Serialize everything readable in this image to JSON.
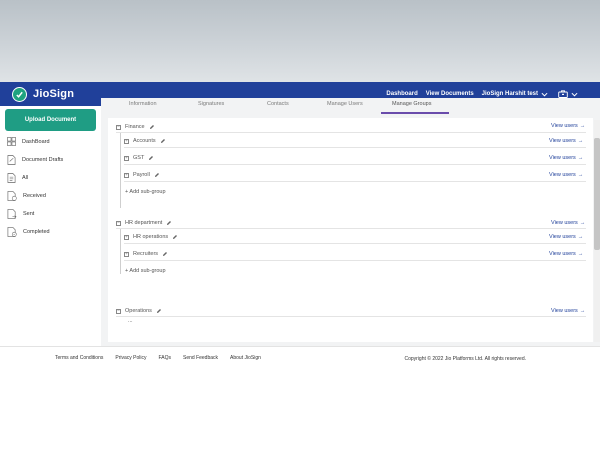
{
  "app": {
    "name": "JioSign"
  },
  "navbar": {
    "links": [
      "Dashboard",
      "View Documents"
    ],
    "user": "JioSign Harshit test",
    "icons": [
      "jiosign-logo-icon",
      "chevron-down-icon",
      "briefcase-icon"
    ]
  },
  "sidebar": {
    "upload_label": "Upload Document",
    "items": [
      {
        "label": "DashBoard",
        "icon": "dashboard-grid-icon"
      },
      {
        "label": "Document Drafts",
        "icon": "document-drafts-icon"
      },
      {
        "label": "All",
        "icon": "all-documents-icon"
      },
      {
        "label": "Received",
        "icon": "received-icon"
      },
      {
        "label": "Sent",
        "icon": "sent-icon"
      },
      {
        "label": "Completed",
        "icon": "completed-icon"
      }
    ]
  },
  "tabs": [
    "Information",
    "Signatures",
    "Contacts",
    "Manage Users",
    "Manage Groups"
  ],
  "active_tab": "Manage Groups",
  "groups": {
    "view_users_label": "View users",
    "add_sub_label": "+ Add sub-group",
    "finance": {
      "name": "Finance",
      "subs": [
        "Accounts",
        "GST",
        "Payroll"
      ]
    },
    "hr": {
      "name": "HR department",
      "subs": [
        "HR operations",
        "Recruiters"
      ]
    },
    "operations": {
      "name": "Operations",
      "more": "..."
    }
  },
  "footer": {
    "links": [
      "Terms and Conditions",
      "Privacy Policy",
      "FAQs",
      "Send Feedback",
      "About JioSign"
    ],
    "copyright": "Copyright © 2022 Jio Platforms Ltd. All rights reserved."
  },
  "colors": {
    "navbar": "#20409a",
    "upload_button": "#1f9d84",
    "active_tab_underline": "#6a4cab",
    "link": "#20409a"
  }
}
